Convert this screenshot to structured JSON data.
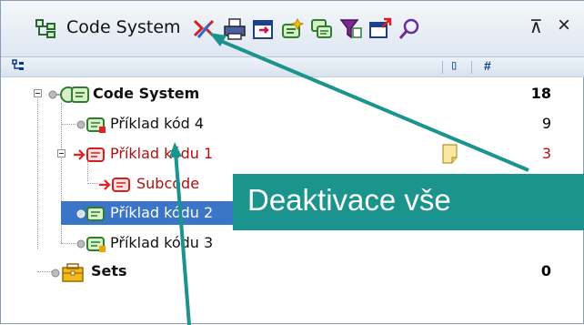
{
  "toolbar": {
    "title": "Code System",
    "icons": [
      "code-system-icon",
      "deactivate-all-icon",
      "print-icon",
      "export-icon",
      "new-code-icon",
      "copy-icon",
      "filter-icon",
      "window-icon",
      "search-icon"
    ],
    "minimize_glyph": "⊼",
    "close_glyph": "×"
  },
  "columns": {
    "memo_header": "▯",
    "count_header": "#"
  },
  "tree": [
    {
      "label": "Code System",
      "count": "18"
    },
    {
      "label": "Příklad kód 4",
      "count": "9"
    },
    {
      "label": "Příklad kódu 1",
      "count": "3"
    },
    {
      "label": "Subcode",
      "count": ""
    },
    {
      "label": "Příklad kódu 2",
      "count": ""
    },
    {
      "label": "Příklad kódu 3",
      "count": ""
    },
    {
      "label": "Sets",
      "count": "0"
    }
  ],
  "annotation": {
    "text": "Deaktivace vše"
  },
  "colors": {
    "selection": "#3a75c7",
    "callout": "#1a948d",
    "activated_code": "#b01010"
  }
}
